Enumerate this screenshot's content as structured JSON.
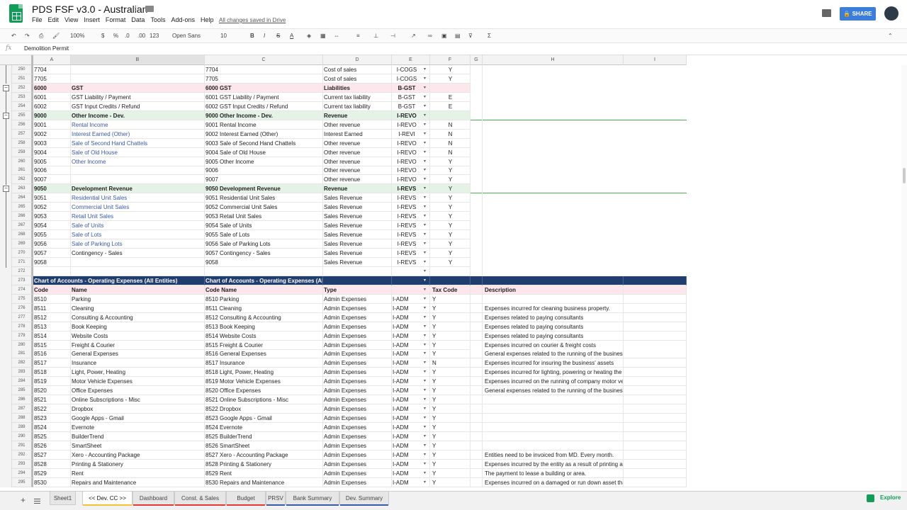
{
  "doc": {
    "title": "PDS FSF v3.0 - Australian",
    "saved": "All changes saved in Drive",
    "share": "SHARE"
  },
  "menu": [
    "File",
    "Edit",
    "View",
    "Insert",
    "Format",
    "Data",
    "Tools",
    "Add-ons",
    "Help"
  ],
  "toolbar": {
    "zoom": "100%",
    "currency": "$",
    "percent": "%",
    "dec_less": ".0",
    "dec_more": ".00",
    "format": "123",
    "font": "Open Sans",
    "size": "10"
  },
  "formula": {
    "label": "fx",
    "value": "Demolition Permit"
  },
  "columns": [
    "A",
    "B",
    "C",
    "D",
    "E",
    "F",
    "G",
    "H",
    "I"
  ],
  "rows": [
    {
      "n": "250",
      "a": "7704",
      "b": "",
      "c": "7704",
      "d": "Cost of sales",
      "e": "I-COGS",
      "f": "Y",
      "h": "",
      "style": ""
    },
    {
      "n": "251",
      "a": "7705",
      "b": "",
      "c": "7705",
      "d": "Cost of sales",
      "e": "I-COGS",
      "f": "Y",
      "h": "",
      "style": ""
    },
    {
      "n": "252",
      "a": "6000",
      "b": "GST",
      "c": "6000 GST",
      "d": "Liabilities",
      "e": "B-GST",
      "f": "",
      "h": "",
      "style": "pink"
    },
    {
      "n": "253",
      "a": "6001",
      "b": "GST Liability / Payment",
      "c": "6001 GST Liability / Payment",
      "d": "Current tax liability",
      "e": "B-GST",
      "f": "E",
      "h": "",
      "style": ""
    },
    {
      "n": "254",
      "a": "6002",
      "b": "GST Input Credits / Refund",
      "c": "6002 GST Input Credits / Refund",
      "d": "Current tax liability",
      "e": "B-GST",
      "f": "E",
      "h": "",
      "style": ""
    },
    {
      "n": "255",
      "a": "9000",
      "b": "Other Income - Dev.",
      "c": "9000 Other Income - Dev.",
      "d": "Revenue",
      "e": "I-REVO",
      "f": "",
      "h": "",
      "style": "green"
    },
    {
      "n": "256",
      "a": "9001",
      "b": "Rental Income",
      "c": "9001 Rental Income",
      "d": "Other revenue",
      "e": "I-REVO",
      "f": "N",
      "h": "",
      "style": "blue"
    },
    {
      "n": "257",
      "a": "9002",
      "b": "Interest Earned (Other)",
      "c": "9002 Interest Earned (Other)",
      "d": "Interest Earned",
      "e": "I-REVI",
      "f": "N",
      "h": "",
      "style": "blue"
    },
    {
      "n": "258",
      "a": "9003",
      "b": "Sale of Second Hand Chattels",
      "c": "9003 Sale of Second Hand Chattels",
      "d": "Other revenue",
      "e": "I-REVO",
      "f": "N",
      "h": "",
      "style": "blue"
    },
    {
      "n": "259",
      "a": "9004",
      "b": "Sale of Old House",
      "c": "9004 Sale of Old House",
      "d": "Other revenue",
      "e": "I-REVO",
      "f": "N",
      "h": "",
      "style": "blue"
    },
    {
      "n": "260",
      "a": "9005",
      "b": "Other Income",
      "c": "9005 Other Income",
      "d": "Other revenue",
      "e": "I-REVO",
      "f": "Y",
      "h": "",
      "style": "blue"
    },
    {
      "n": "261",
      "a": "9006",
      "b": "",
      "c": "9006",
      "d": "Other revenue",
      "e": "I-REVO",
      "f": "Y",
      "h": "",
      "style": ""
    },
    {
      "n": "262",
      "a": "9007",
      "b": "",
      "c": "9007",
      "d": "Other revenue",
      "e": "I-REVO",
      "f": "Y",
      "h": "",
      "style": ""
    },
    {
      "n": "263",
      "a": "9050",
      "b": "Development Revenue",
      "c": "9050 Development Revenue",
      "d": "Revenue",
      "e": "I-REVS",
      "f": "Y",
      "h": "",
      "style": "green"
    },
    {
      "n": "264",
      "a": "9051",
      "b": "Residential Unit Sales",
      "c": "9051 Residential Unit Sales",
      "d": "Sales Revenue",
      "e": "I-REVS",
      "f": "Y",
      "h": "",
      "style": "blue"
    },
    {
      "n": "265",
      "a": "9052",
      "b": "Commercial Unit Sales",
      "c": "9052 Commercial Unit Sales",
      "d": "Sales Revenue",
      "e": "I-REVS",
      "f": "Y",
      "h": "",
      "style": "blue"
    },
    {
      "n": "266",
      "a": "9053",
      "b": "Retail Unit Sales",
      "c": "9053 Retail Unit Sales",
      "d": "Sales Revenue",
      "e": "I-REVS",
      "f": "Y",
      "h": "",
      "style": "blue"
    },
    {
      "n": "267",
      "a": "9054",
      "b": "Sale of Units",
      "c": "9054 Sale of Units",
      "d": "Sales Revenue",
      "e": "I-REVS",
      "f": "Y",
      "h": "",
      "style": "blue"
    },
    {
      "n": "268",
      "a": "9055",
      "b": "Sale of Lots",
      "c": "9055 Sale of Lots",
      "d": "Sales Revenue",
      "e": "I-REVS",
      "f": "Y",
      "h": "",
      "style": "blue"
    },
    {
      "n": "269",
      "a": "9056",
      "b": "Sale of Parking Lots",
      "c": "9056 Sale of Parking Lots",
      "d": "Sales Revenue",
      "e": "I-REVS",
      "f": "Y",
      "h": "",
      "style": "blue"
    },
    {
      "n": "270",
      "a": "9057",
      "b": "Contingency - Sales",
      "c": "9057 Contingency - Sales",
      "d": "Sales Revenue",
      "e": "I-REVS",
      "f": "Y",
      "h": "",
      "style": ""
    },
    {
      "n": "271",
      "a": "9058",
      "b": "",
      "c": "9058",
      "d": "Sales Revenue",
      "e": "I-REVS",
      "f": "Y",
      "h": "",
      "style": ""
    },
    {
      "n": "272",
      "a": "",
      "b": "",
      "c": "",
      "d": "",
      "e": "",
      "f": "",
      "h": "",
      "style": ""
    },
    {
      "n": "273",
      "a": "Chart of Accounts - Operating Expenses (All Entities)",
      "b": "",
      "c": "Chart of Accounts - Operating Expenses (All Entities)",
      "d": "",
      "e": "",
      "f": "",
      "h": "",
      "style": "navy"
    },
    {
      "n": "274",
      "a": "Code",
      "b": "Name",
      "c": "Code Name",
      "d": "Type",
      "e": "",
      "f": "Tax Code",
      "h": "Description",
      "style": "hpink"
    },
    {
      "n": "275",
      "a": "8510",
      "b": "Parking",
      "c": "8510 Parking",
      "d": "Admin Expenses",
      "e": "I-ADM",
      "f": "Y",
      "h": "",
      "style": "exp"
    },
    {
      "n": "276",
      "a": "8511",
      "b": "Cleaning",
      "c": "8511 Cleaning",
      "d": "Admin Expenses",
      "e": "I-ADM",
      "f": "Y",
      "h": "Expenses incurred for cleaning business property.",
      "style": "exp"
    },
    {
      "n": "277",
      "a": "8512",
      "b": "Consulting & Accounting",
      "c": "8512 Consulting & Accounting",
      "d": "Admin Expenses",
      "e": "I-ADM",
      "f": "Y",
      "h": "Expenses related to paying consultants",
      "style": "exp"
    },
    {
      "n": "278",
      "a": "8513",
      "b": "Book Keeping",
      "c": "8513 Book Keeping",
      "d": "Admin Expenses",
      "e": "I-ADM",
      "f": "Y",
      "h": "Expenses related to paying consultants",
      "style": "exp"
    },
    {
      "n": "279",
      "a": "8514",
      "b": "Website Costs",
      "c": "8514 Website Costs",
      "d": "Admin Expenses",
      "e": "I-ADM",
      "f": "Y",
      "h": "Expenses related to paying consultants",
      "style": "exp"
    },
    {
      "n": "280",
      "a": "8515",
      "b": "Freight & Courier",
      "c": "8515 Freight & Courier",
      "d": "Admin Expenses",
      "e": "I-ADM",
      "f": "Y",
      "h": "Expenses incurred on courier & freight costs",
      "style": "exp"
    },
    {
      "n": "281",
      "a": "8516",
      "b": "General Expenses",
      "c": "8516 General Expenses",
      "d": "Admin Expenses",
      "e": "I-ADM",
      "f": "Y",
      "h": "General expenses related to the running of the business.",
      "style": "exp"
    },
    {
      "n": "282",
      "a": "8517",
      "b": "Insurance",
      "c": "8517 Insurance",
      "d": "Admin Expenses",
      "e": "I-ADM",
      "f": "N",
      "h": "Expenses incurred for insuring the business' assets",
      "style": "exp"
    },
    {
      "n": "283",
      "a": "8518",
      "b": "Light, Power, Heating",
      "c": "8518 Light, Power, Heating",
      "d": "Admin Expenses",
      "e": "I-ADM",
      "f": "Y",
      "h": "Expenses incurred for lighting, powering or heating the premises",
      "style": "exp"
    },
    {
      "n": "284",
      "a": "8519",
      "b": "Motor Vehicle Expenses",
      "c": "8519 Motor Vehicle Expenses",
      "d": "Admin Expenses",
      "e": "I-ADM",
      "f": "Y",
      "h": "Expenses incurred on the running of company motor vehicles",
      "style": "exp"
    },
    {
      "n": "285",
      "a": "8520",
      "b": "Office Expenses",
      "c": "8520 Office Expenses",
      "d": "Admin Expenses",
      "e": "I-ADM",
      "f": "Y",
      "h": "General expenses related to the running of the business office.",
      "style": "exp"
    },
    {
      "n": "286",
      "a": "8521",
      "b": "Online Subscriptions - Misc",
      "c": "8521 Online Subscriptions - Misc",
      "d": "Admin Expenses",
      "e": "I-ADM",
      "f": "Y",
      "h": "",
      "style": "exp"
    },
    {
      "n": "287",
      "a": "8522",
      "b": "Dropbox",
      "c": "8522 Dropbox",
      "d": "Admin Expenses",
      "e": "I-ADM",
      "f": "Y",
      "h": "",
      "style": "exp"
    },
    {
      "n": "288",
      "a": "8523",
      "b": "Google Apps - Gmail",
      "c": "8523 Google Apps - Gmail",
      "d": "Admin Expenses",
      "e": "I-ADM",
      "f": "Y",
      "h": "",
      "style": "exp"
    },
    {
      "n": "289",
      "a": "8524",
      "b": "Evernote",
      "c": "8524 Evernote",
      "d": "Admin Expenses",
      "e": "I-ADM",
      "f": "Y",
      "h": "",
      "style": "exp"
    },
    {
      "n": "290",
      "a": "8525",
      "b": "BuilderTrend",
      "c": "8525 BuilderTrend",
      "d": "Admin Expenses",
      "e": "I-ADM",
      "f": "Y",
      "h": "",
      "style": "exp"
    },
    {
      "n": "291",
      "a": "8526",
      "b": "SmartSheet",
      "c": "8526 SmartSheet",
      "d": "Admin Expenses",
      "e": "I-ADM",
      "f": "Y",
      "h": "",
      "style": "exp"
    },
    {
      "n": "292",
      "a": "8527",
      "b": "Xero - Accounting Package",
      "c": "8527 Xero - Accounting Package",
      "d": "Admin Expenses",
      "e": "I-ADM",
      "f": "Y",
      "h": "Entities need to be invoiced from MD. Every month.",
      "style": "exp"
    },
    {
      "n": "293",
      "a": "8528",
      "b": "Printing & Stationery",
      "c": "8528 Printing & Stationery",
      "d": "Admin Expenses",
      "e": "I-ADM",
      "f": "Y",
      "h": "Expenses incurred by the entity as a result of printing and stationery",
      "style": "exp"
    },
    {
      "n": "294",
      "a": "8529",
      "b": "Rent",
      "c": "8529 Rent",
      "d": "Admin Expenses",
      "e": "I-ADM",
      "f": "Y",
      "h": "The payment to lease a building or area.",
      "style": "exp"
    },
    {
      "n": "295",
      "a": "8530",
      "b": "Repairs and Maintenance",
      "c": "8530 Repairs and Maintenance",
      "d": "Admin Expenses",
      "e": "I-ADM",
      "f": "Y",
      "h": "Expenses incurred on a damaged or run down asset that will bring the asset",
      "style": "exp"
    }
  ],
  "tabs": [
    {
      "label": "Sheet1",
      "color": "",
      "active": false
    },
    {
      "label": "<< Dev. CC >>",
      "color": "#f4c430",
      "active": true
    },
    {
      "label": "Dashboard",
      "color": "#e53935",
      "active": false
    },
    {
      "label": "Const. & Sales",
      "color": "#e53935",
      "active": false
    },
    {
      "label": "Budget",
      "color": "#e53935",
      "active": false
    },
    {
      "label": "PRSV",
      "color": "#3b5aa8",
      "active": false
    },
    {
      "label": "Bank Summary",
      "color": "#3b5aa8",
      "active": false
    },
    {
      "label": "Dev. Summary",
      "color": "#3b5aa8",
      "active": false
    }
  ],
  "explore": "Explore"
}
